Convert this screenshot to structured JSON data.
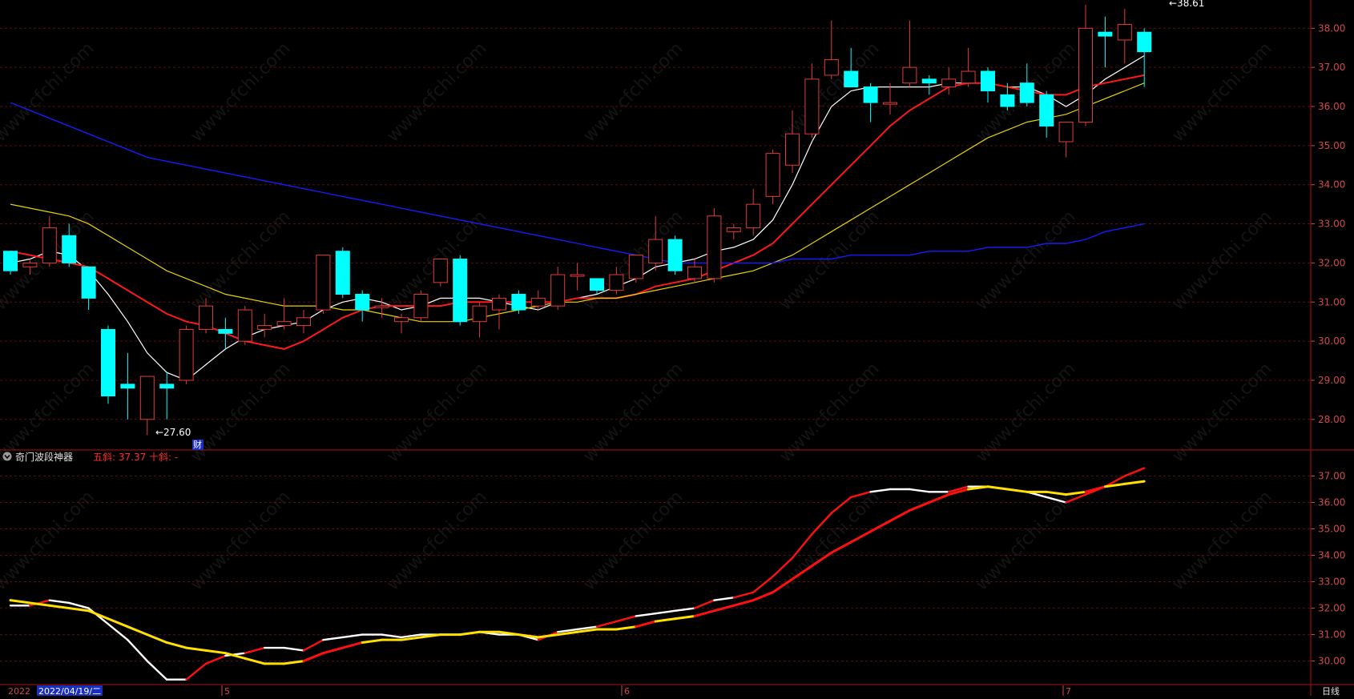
{
  "colors": {
    "background": "#000000",
    "frame": "#b01010",
    "grid": "#5a0d0d",
    "axis_text": "#d24a4a",
    "up": "#e23a3a",
    "down": "#00ffff",
    "ma_white": "#ffffff",
    "ma_red": "#ff1a1a",
    "ma_yellow": "#e6d200",
    "ma_blue": "#1a1aff",
    "indicator_red": "#ff1010",
    "indicator_yellow": "#ffe000",
    "indicator_white": "#ffffff"
  },
  "watermark": "www.cfchi.com",
  "main_panel": {
    "annotations": {
      "low_label": "←27.60",
      "high_label": "←38.61",
      "event_marker": "财"
    }
  },
  "indicator_panel": {
    "collapse_icon": "circle-chevron-down-icon",
    "name": "奇门波段神器",
    "readout": "五斜: 37.37  十斜: -"
  },
  "time_axis": {
    "labels": [
      "2022",
      "2022/04/19/二",
      "5",
      "6",
      "7"
    ],
    "period_button": "日线"
  },
  "chart_data": [
    {
      "type": "candlestick",
      "title": "",
      "ylim": [
        27.3,
        38.6
      ],
      "y_ticks": [
        28.0,
        29.0,
        30.0,
        31.0,
        32.0,
        33.0,
        34.0,
        35.0,
        36.0,
        37.0,
        38.0
      ],
      "y_tick_labels": [
        "28.00",
        "29.00",
        "30.00",
        "31.00",
        "32.00",
        "33.00",
        "34.00",
        "35.00",
        "36.00",
        "37.00",
        "38.00"
      ],
      "grid": true,
      "candles": [
        [
          32.3,
          31.8,
          32.3,
          31.7
        ],
        [
          31.9,
          32.0,
          32.1,
          31.7
        ],
        [
          32.0,
          32.9,
          33.2,
          31.9
        ],
        [
          32.7,
          32.0,
          33.0,
          31.9
        ],
        [
          31.9,
          31.1,
          31.9,
          30.8
        ],
        [
          30.3,
          28.6,
          30.4,
          28.4
        ],
        [
          28.9,
          28.8,
          29.7,
          28.0
        ],
        [
          28.0,
          29.1,
          29.1,
          27.6
        ],
        [
          28.9,
          28.8,
          29.2,
          28.0
        ],
        [
          29.0,
          30.3,
          30.4,
          28.9
        ],
        [
          30.3,
          30.9,
          31.1,
          30.2
        ],
        [
          30.3,
          30.2,
          30.6,
          29.8
        ],
        [
          30.0,
          30.8,
          30.9,
          29.9
        ],
        [
          30.3,
          30.4,
          30.7,
          30.1
        ],
        [
          30.4,
          30.5,
          31.1,
          30.3
        ],
        [
          30.4,
          30.6,
          30.8,
          30.2
        ],
        [
          30.8,
          32.2,
          32.2,
          30.7
        ],
        [
          32.3,
          31.2,
          32.4,
          31.1
        ],
        [
          31.2,
          30.8,
          31.3,
          30.5
        ],
        [
          30.9,
          30.9,
          31.1,
          30.6
        ],
        [
          30.5,
          30.6,
          30.7,
          30.2
        ],
        [
          30.6,
          31.2,
          31.3,
          30.5
        ],
        [
          31.5,
          32.1,
          32.1,
          31.4
        ],
        [
          32.1,
          30.5,
          32.2,
          30.4
        ],
        [
          30.5,
          30.9,
          31.0,
          30.1
        ],
        [
          30.8,
          31.1,
          31.2,
          30.3
        ],
        [
          31.2,
          30.8,
          31.3,
          30.7
        ],
        [
          30.9,
          31.1,
          31.3,
          30.8
        ],
        [
          30.9,
          31.7,
          31.9,
          30.8
        ],
        [
          31.7,
          31.7,
          32.0,
          31.3
        ],
        [
          31.6,
          31.3,
          31.6,
          31.2
        ],
        [
          31.3,
          31.7,
          31.9,
          31.2
        ],
        [
          31.6,
          32.2,
          32.2,
          31.5
        ],
        [
          32.0,
          32.6,
          33.2,
          31.8
        ],
        [
          32.6,
          31.8,
          32.7,
          31.7
        ],
        [
          31.6,
          31.9,
          32.1,
          31.5
        ],
        [
          31.6,
          33.2,
          33.4,
          31.5
        ],
        [
          32.8,
          32.9,
          33.0,
          32.6
        ],
        [
          32.9,
          33.5,
          33.9,
          32.7
        ],
        [
          33.7,
          34.8,
          34.9,
          33.5
        ],
        [
          34.5,
          35.3,
          35.9,
          34.3
        ],
        [
          35.3,
          36.7,
          37.1,
          35.2
        ],
        [
          36.8,
          37.2,
          38.2,
          36.7
        ],
        [
          36.9,
          36.5,
          37.5,
          36.5
        ],
        [
          36.5,
          36.1,
          36.6,
          35.6
        ],
        [
          36.1,
          36.1,
          36.6,
          35.8
        ],
        [
          36.6,
          37.0,
          38.2,
          36.5
        ],
        [
          36.7,
          36.6,
          36.8,
          36.3
        ],
        [
          36.5,
          36.7,
          37.0,
          36.3
        ],
        [
          36.6,
          36.9,
          37.5,
          36.5
        ],
        [
          36.9,
          36.4,
          37.0,
          36.1
        ],
        [
          36.3,
          36.0,
          36.6,
          35.9
        ],
        [
          36.6,
          36.1,
          37.1,
          36.0
        ],
        [
          36.3,
          35.5,
          36.4,
          35.2
        ],
        [
          35.1,
          35.6,
          35.6,
          34.7
        ],
        [
          35.6,
          38.0,
          38.6,
          35.5
        ],
        [
          37.9,
          37.8,
          38.3,
          37.0
        ],
        [
          37.7,
          38.1,
          38.5,
          37.1
        ],
        [
          37.9,
          37.4,
          38.0,
          36.5
        ]
      ],
      "series": [
        {
          "color_key": "ma_white",
          "values": [
            32.0,
            32.1,
            32.3,
            32.2,
            31.8,
            31.2,
            30.5,
            29.7,
            29.2,
            29.0,
            29.4,
            29.8,
            30.1,
            30.3,
            30.4,
            30.5,
            30.8,
            31.0,
            31.1,
            31.0,
            30.8,
            30.9,
            31.1,
            31.1,
            31.1,
            31.0,
            30.9,
            30.8,
            31.0,
            31.1,
            31.2,
            31.4,
            31.6,
            31.9,
            32.0,
            32.1,
            32.3,
            32.4,
            32.6,
            33.1,
            34.0,
            35.1,
            36.0,
            36.4,
            36.5,
            36.5,
            36.5,
            36.5,
            36.6,
            36.6,
            36.6,
            36.5,
            36.5,
            36.3,
            36.0,
            36.3,
            36.7,
            37.0,
            37.3
          ]
        },
        {
          "color_key": "ma_red",
          "values": [
            32.3,
            32.2,
            32.1,
            32.0,
            31.9,
            31.6,
            31.3,
            31.0,
            30.7,
            30.5,
            30.4,
            30.2,
            30.0,
            29.9,
            29.8,
            30.0,
            30.3,
            30.6,
            30.8,
            30.9,
            30.9,
            30.9,
            30.9,
            31.0,
            31.0,
            31.0,
            31.0,
            31.0,
            31.0,
            31.1,
            31.1,
            31.1,
            31.2,
            31.4,
            31.5,
            31.6,
            31.8,
            32.0,
            32.2,
            32.5,
            33.0,
            33.5,
            34.0,
            34.5,
            35.0,
            35.5,
            35.9,
            36.2,
            36.5,
            36.6,
            36.6,
            36.5,
            36.4,
            36.3,
            36.3,
            36.5,
            36.6,
            36.7,
            36.8
          ]
        },
        {
          "color_key": "ma_yellow",
          "values": [
            33.5,
            33.4,
            33.3,
            33.2,
            33.0,
            32.7,
            32.4,
            32.1,
            31.8,
            31.6,
            31.4,
            31.2,
            31.1,
            31.0,
            30.9,
            30.9,
            30.9,
            30.8,
            30.8,
            30.7,
            30.6,
            30.5,
            30.5,
            30.5,
            30.6,
            30.7,
            30.8,
            30.9,
            31.0,
            31.0,
            31.1,
            31.1,
            31.2,
            31.3,
            31.4,
            31.5,
            31.6,
            31.7,
            31.8,
            32.0,
            32.2,
            32.5,
            32.8,
            33.1,
            33.4,
            33.7,
            34.0,
            34.3,
            34.6,
            34.9,
            35.2,
            35.4,
            35.6,
            35.7,
            35.8,
            36.0,
            36.2,
            36.4,
            36.6
          ]
        },
        {
          "color_key": "ma_blue",
          "values": [
            36.1,
            35.9,
            35.7,
            35.5,
            35.3,
            35.1,
            34.9,
            34.7,
            34.6,
            34.5,
            34.4,
            34.3,
            34.2,
            34.1,
            34.0,
            33.9,
            33.8,
            33.7,
            33.6,
            33.5,
            33.4,
            33.3,
            33.2,
            33.1,
            33.0,
            32.9,
            32.8,
            32.7,
            32.6,
            32.5,
            32.4,
            32.3,
            32.2,
            32.1,
            32.0,
            32.0,
            32.0,
            32.0,
            32.0,
            32.0,
            32.1,
            32.1,
            32.1,
            32.2,
            32.2,
            32.2,
            32.2,
            32.3,
            32.3,
            32.3,
            32.4,
            32.4,
            32.4,
            32.5,
            32.5,
            32.6,
            32.8,
            32.9,
            33.0
          ]
        }
      ]
    },
    {
      "type": "line",
      "title": "",
      "ylim": [
        29.2,
        37.5
      ],
      "y_ticks": [
        30.0,
        31.0,
        32.0,
        33.0,
        34.0,
        35.0,
        36.0,
        37.0
      ],
      "y_tick_labels": [
        "30.00",
        "31.00",
        "32.00",
        "33.00",
        "34.00",
        "35.00",
        "36.00",
        "37.00"
      ],
      "grid": true,
      "series": [
        {
          "color_key": "indicator_white",
          "values": [
            32.1,
            32.1,
            32.3,
            32.2,
            32.0,
            31.4,
            30.8,
            30.0,
            29.3,
            29.3,
            29.9,
            30.2,
            30.3,
            30.5,
            30.5,
            30.4,
            30.8,
            30.9,
            31.0,
            31.0,
            30.9,
            31.0,
            31.0,
            31.0,
            31.1,
            31.0,
            31.0,
            30.8,
            31.1,
            31.2,
            31.3,
            31.5,
            31.7,
            31.8,
            31.9,
            32.0,
            32.3,
            32.4,
            32.6,
            33.2,
            33.9,
            34.8,
            35.6,
            36.2,
            36.4,
            36.5,
            36.5,
            36.4,
            36.4,
            36.6,
            36.6,
            36.5,
            36.4,
            36.2,
            36.0,
            36.3,
            36.6,
            37.0,
            37.3
          ]
        },
        {
          "color_key": "indicator_yellow",
          "values": [
            32.3,
            32.2,
            32.1,
            32.0,
            31.9,
            31.6,
            31.3,
            31.0,
            30.7,
            30.5,
            30.4,
            30.3,
            30.1,
            29.9,
            29.9,
            30.0,
            30.3,
            30.5,
            30.7,
            30.8,
            30.8,
            30.9,
            31.0,
            31.0,
            31.1,
            31.1,
            31.0,
            30.9,
            31.0,
            31.1,
            31.2,
            31.2,
            31.3,
            31.5,
            31.6,
            31.7,
            31.9,
            32.1,
            32.3,
            32.6,
            33.1,
            33.6,
            34.1,
            34.5,
            34.9,
            35.3,
            35.7,
            36.0,
            36.3,
            36.5,
            36.6,
            36.5,
            36.4,
            36.4,
            36.3,
            36.4,
            36.6,
            36.7,
            36.8
          ]
        }
      ]
    }
  ]
}
